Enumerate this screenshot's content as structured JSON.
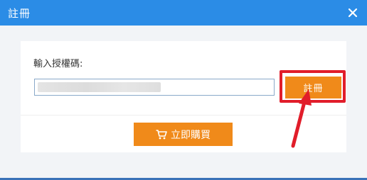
{
  "window": {
    "title": "註冊",
    "close_icon": "close-icon"
  },
  "form": {
    "label": "輸入授權碼:",
    "code_value": "",
    "register_label": "註冊"
  },
  "purchase": {
    "buy_label": "立即購買",
    "icon": "cart-icon"
  },
  "colors": {
    "titlebar": "#2b8ce6",
    "accent_button": "#f08a1a",
    "annotation": "#e11d2a"
  }
}
